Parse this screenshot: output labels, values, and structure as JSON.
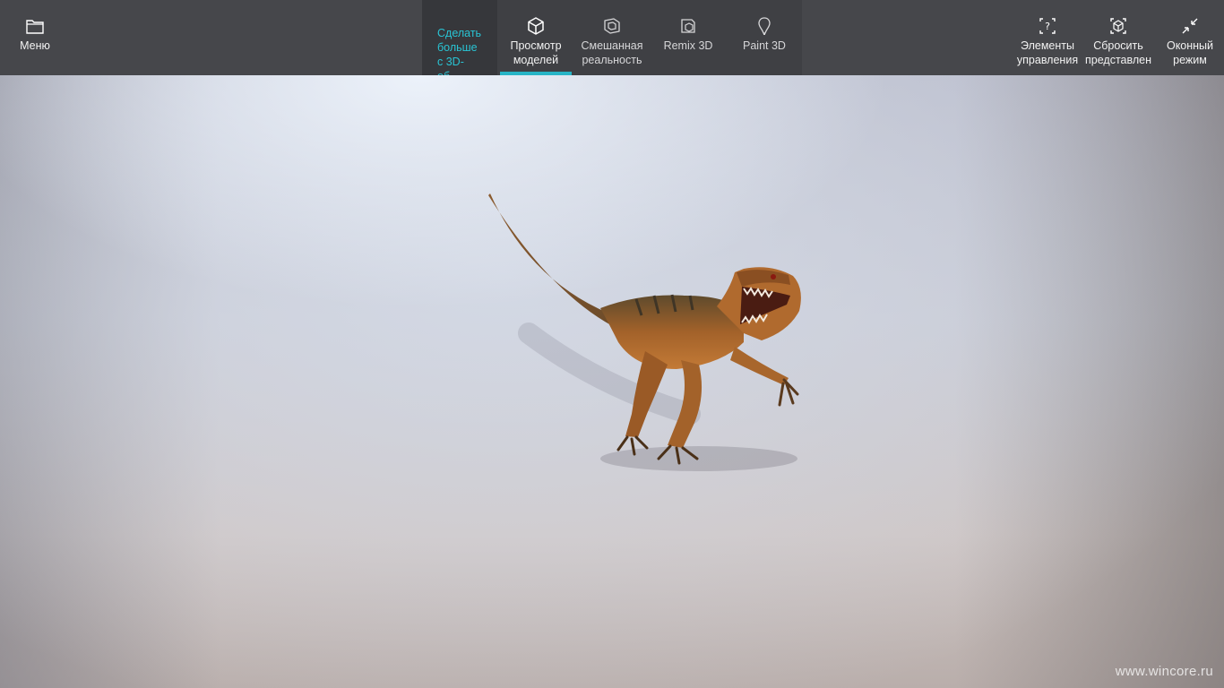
{
  "toolbar": {
    "menu": {
      "label": "Меню",
      "icon": "folder-icon"
    },
    "promo": {
      "label": "Сделать\nбольше\nс 3D-\nоб..."
    },
    "tabs": [
      {
        "label": "Просмотр\nмоделей",
        "icon": "cube-icon",
        "active": true
      },
      {
        "label": "Смешанная\nреальность",
        "icon": "mixed-reality-icon",
        "active": false
      },
      {
        "label": "Remix 3D",
        "icon": "remix3d-icon",
        "active": false
      },
      {
        "label": "Paint 3D",
        "icon": "paint3d-icon",
        "active": false
      }
    ],
    "right": [
      {
        "label": "Элементы\nуправления",
        "icon": "controls-help-icon"
      },
      {
        "label": "Сбросить\nпредставлен",
        "icon": "reset-view-icon"
      },
      {
        "label": "Оконный\nрежим",
        "icon": "window-mode-icon"
      }
    ]
  },
  "watermark": "www.wincore.ru",
  "colors": {
    "toolbar_bg": "#46474b",
    "accent": "#27b4c6",
    "promo_text": "#29c4d4"
  }
}
